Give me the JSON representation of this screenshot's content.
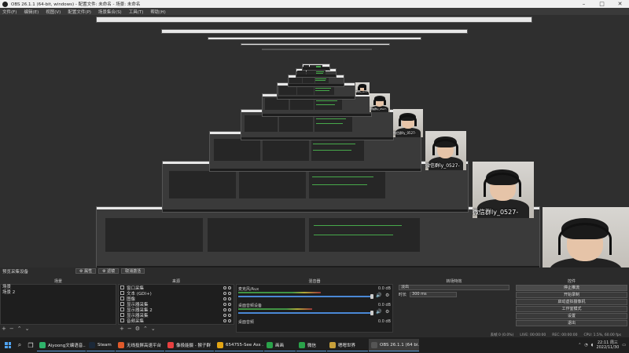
{
  "window": {
    "title": "OBS 26.1.1 (64-bit, windows) - 配置文件: 未命名 - 场景: 未命名"
  },
  "menu": [
    "文件(F)",
    "编辑(E)",
    "视图(V)",
    "配置文件(P)",
    "场景集合(S)",
    "工具(T)",
    "帮助(H)"
  ],
  "preview": {
    "watermark": "微信群ly_0527-"
  },
  "dock_bar": {
    "label": "预览采集设备",
    "btn_scene": "⚙ 属性",
    "btn_filter": "⚙ 滤镜",
    "btn_device": "取消激活"
  },
  "scenes": {
    "header": "场景",
    "items": [
      "场景",
      "场景 2"
    ]
  },
  "sources": {
    "header": "来源",
    "items": [
      "窗口采集",
      "文本 (GDI+)",
      "图像",
      "显示器采集",
      "显示器采集 2",
      "显示器采集",
      "音频采集"
    ]
  },
  "mixer": {
    "header": "混音器",
    "channels": [
      {
        "name": "麦克风/Aux",
        "db": "0.0 dB",
        "level": 0.62
      },
      {
        "name": "桌面音频设备",
        "db": "0.0 dB",
        "level": 0.55
      },
      {
        "name": "桌面音频",
        "db": "0.0 dB",
        "level": 0.0
      }
    ]
  },
  "transitions": {
    "header": "转场特效",
    "type": "淡出",
    "duration_label": "时长",
    "duration": "300 ms"
  },
  "controls": {
    "header": "控件",
    "buttons": [
      "停止推流",
      "开始录制",
      "启动虚拟摄像机",
      "工作室模式",
      "设置",
      "退出"
    ]
  },
  "status": {
    "live": "LIVE: 00:00:00",
    "rec": "REC: 00:00:00",
    "cpu": "CPU: 1.5%, 60.00 fps",
    "dropped": "丢帧 0 (0.0%)"
  },
  "taskbar": {
    "tasks": [
      {
        "label": "Aiyoong文编语音...",
        "color": "#2fb36b"
      },
      {
        "label": "Steam",
        "color": "#1b2838"
      },
      {
        "label": "无线投屏高速平台",
        "color": "#e05a2a"
      },
      {
        "label": "像极能摄 - 猴子群",
        "color": "#e84040"
      },
      {
        "label": "654755-See Ass ...",
        "color": "#e3a514"
      },
      {
        "label": "画画",
        "color": "#2aa34a"
      },
      {
        "label": "微信",
        "color": "#2aa34a"
      },
      {
        "label": "嗯嗯世界",
        "color": "#c8a03a"
      },
      {
        "label": "OBS 26.1.1 (64 bi...",
        "color": "#555555"
      }
    ],
    "time": "22:11 周三",
    "date": "2022/11/30"
  }
}
